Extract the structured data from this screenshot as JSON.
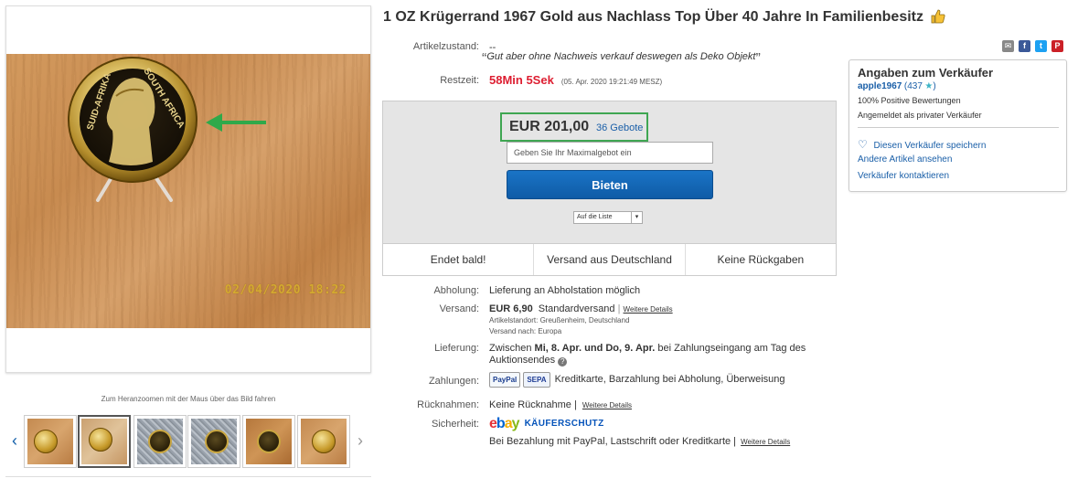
{
  "listing": {
    "title": "1 OZ Krügerrand 1967 Gold aus Nachlass Top Über 40 Jahre In Familienbesitz"
  },
  "gallery": {
    "photo_timestamp": "02/04/2020 18:22",
    "zoom_hint": "Zum Heranzoomen mit der Maus über das Bild fahren",
    "thumbnails": [
      "wood-coin",
      "wood-coin-stand",
      "stone-coin",
      "stone-coin",
      "wood-coin-reverse",
      "wood-coin-obverse"
    ],
    "active_index": 1
  },
  "condition": {
    "label": "Artikelzustand:",
    "value": "--",
    "note": "Gut aber ohne Nachweis verkauf deswegen als Deko Objekt"
  },
  "remaining": {
    "label": "Restzeit:",
    "timer": "58Min 5Sek",
    "end_date": "(05. Apr. 2020   19:21:49 MESZ)"
  },
  "bid": {
    "price": "EUR 201,00",
    "bids_count": "36 Gebote",
    "input_placeholder": "Geben Sie Ihr Maximalgebot ein",
    "button_label": "Bieten",
    "watch_list": "Auf die Liste"
  },
  "info_strip": [
    "Endet bald!",
    "Versand aus Deutschland",
    "Keine Rückgaben"
  ],
  "details": {
    "pickup": {
      "label": "Abholung:",
      "value": "Lieferung an Abholstation möglich"
    },
    "shipping": {
      "label": "Versand:",
      "price": "EUR 6,90",
      "method": "Standardversand",
      "more": "Weitere Details",
      "location": "Artikelstandort:  Greußenheim, Deutschland",
      "ships_to": "Versand nach:   Europa"
    },
    "delivery": {
      "label": "Lieferung:",
      "prefix": "Zwischen ",
      "dates": "Mi, 8. Apr. und Do, 9. Apr.",
      "suffix": " bei Zahlungseingang am Tag des",
      "line2": "Auktionsendes"
    },
    "payment": {
      "label": "Zahlungen:",
      "paypal": "PayPal",
      "sepa": "SEPA",
      "methods": "Kreditkarte, Barzahlung bei Abholung, Überweisung"
    },
    "returns": {
      "label": "Rücknahmen:",
      "value": "Keine Rücknahme |",
      "more": "Weitere Details"
    },
    "security": {
      "label": "Sicherheit:",
      "protection": "KÄUFERSCHUTZ",
      "text": "Bei Bezahlung mit PayPal, Lastschrift oder Kreditkarte |",
      "more": "Weitere Details"
    }
  },
  "seller": {
    "heading": "Angaben zum Verkäufer",
    "name": "apple1967",
    "score": "(437",
    "score_close": ")",
    "positive": "100% Positive Bewertungen",
    "type": "Angemeldet als privater Verkäufer",
    "save": "Diesen Verkäufer speichern",
    "other_items": "Andere Artikel ansehen",
    "contact": "Verkäufer kontaktieren"
  },
  "colors": {
    "timer": "#dd1e31",
    "link": "#1a5fa8",
    "bid_button": "#1a74c6",
    "highlight": "#3fa652"
  }
}
